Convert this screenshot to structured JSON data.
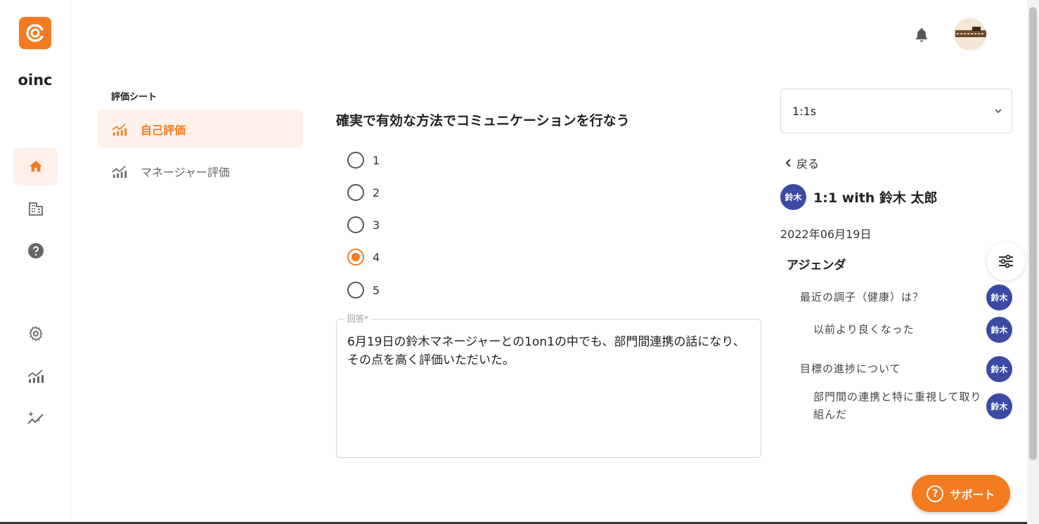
{
  "brand": {
    "name": "oinc"
  },
  "sheet_nav": {
    "title": "評価シート",
    "items": [
      {
        "label": "自己評価",
        "active": true
      },
      {
        "label": "マネージャー評価",
        "active": false
      }
    ]
  },
  "question": {
    "text": "確実で有効な方法でコミュニケーションを行なう",
    "options": [
      "1",
      "2",
      "3",
      "4",
      "5"
    ],
    "selected": "4"
  },
  "answer": {
    "label": "回答*",
    "text": "6月19日の鈴木マネージャーとの1on1の中でも、部門間連携の話になり、その点を高く評価いただいた。"
  },
  "right_panel": {
    "select_value": "1:1s",
    "back_label": "戻る",
    "meeting_avatar": "鈴木",
    "meeting_title": "1:1 with 鈴木 太郎",
    "date": "2022年06月19日",
    "agenda_title": "アジェンダ",
    "agenda": [
      {
        "text": "最近の調子（健康）は？",
        "avatar": "鈴木"
      },
      {
        "text": "以前より良くなった",
        "avatar": "鈴木"
      },
      {
        "text": "目標の進捗について",
        "avatar": "鈴木"
      },
      {
        "text": "部門間の連携と特に重視して取り組んだ",
        "avatar": "鈴木"
      }
    ]
  },
  "support_label": "サポート",
  "colors": {
    "accent": "#f47b20",
    "avatar_blue": "#3b4aa3",
    "active_bg": "#fdf1ea"
  },
  "icons": [
    "logo-icon",
    "home-icon",
    "building-icon",
    "help-icon",
    "gear-icon",
    "chart-icon",
    "sparkle-chart-icon",
    "bell-icon",
    "filter-icon",
    "chevron-down-icon",
    "chevron-left-icon"
  ]
}
